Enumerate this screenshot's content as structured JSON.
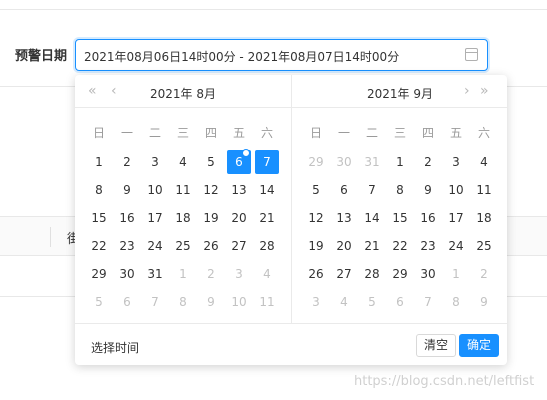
{
  "form": {
    "label": "预警日期",
    "range_value": "2021年08月06日14时00分 - 2021年08月07日14时00分"
  },
  "table": {
    "header_partial_text": "街"
  },
  "picker": {
    "nav": {
      "prev_year": "«",
      "prev_month": "‹",
      "next_month": "›",
      "next_year": "»"
    },
    "weekdays": [
      "日",
      "一",
      "二",
      "三",
      "四",
      "五",
      "六"
    ],
    "left": {
      "title": "2021年 8月",
      "days": [
        {
          "d": "1",
          "m": 0
        },
        {
          "d": "2",
          "m": 0
        },
        {
          "d": "3",
          "m": 0
        },
        {
          "d": "4",
          "m": 0
        },
        {
          "d": "5",
          "m": 0
        },
        {
          "d": "6",
          "m": 0,
          "sel": 1,
          "today": 1
        },
        {
          "d": "7",
          "m": 0,
          "sel": 1
        },
        {
          "d": "8",
          "m": 0
        },
        {
          "d": "9",
          "m": 0
        },
        {
          "d": "10",
          "m": 0
        },
        {
          "d": "11",
          "m": 0
        },
        {
          "d": "12",
          "m": 0
        },
        {
          "d": "13",
          "m": 0
        },
        {
          "d": "14",
          "m": 0
        },
        {
          "d": "15",
          "m": 0
        },
        {
          "d": "16",
          "m": 0
        },
        {
          "d": "17",
          "m": 0
        },
        {
          "d": "18",
          "m": 0
        },
        {
          "d": "19",
          "m": 0
        },
        {
          "d": "20",
          "m": 0
        },
        {
          "d": "21",
          "m": 0
        },
        {
          "d": "22",
          "m": 0
        },
        {
          "d": "23",
          "m": 0
        },
        {
          "d": "24",
          "m": 0
        },
        {
          "d": "25",
          "m": 0
        },
        {
          "d": "26",
          "m": 0
        },
        {
          "d": "27",
          "m": 0
        },
        {
          "d": "28",
          "m": 0
        },
        {
          "d": "29",
          "m": 0
        },
        {
          "d": "30",
          "m": 0
        },
        {
          "d": "31",
          "m": 0
        },
        {
          "d": "1",
          "m": 1
        },
        {
          "d": "2",
          "m": 1
        },
        {
          "d": "3",
          "m": 1
        },
        {
          "d": "4",
          "m": 1
        },
        {
          "d": "5",
          "m": 1
        },
        {
          "d": "6",
          "m": 1
        },
        {
          "d": "7",
          "m": 1
        },
        {
          "d": "8",
          "m": 1
        },
        {
          "d": "9",
          "m": 1
        },
        {
          "d": "10",
          "m": 1
        },
        {
          "d": "11",
          "m": 1
        }
      ]
    },
    "right": {
      "title": "2021年 9月",
      "days": [
        {
          "d": "29",
          "m": 1
        },
        {
          "d": "30",
          "m": 1
        },
        {
          "d": "31",
          "m": 1
        },
        {
          "d": "1",
          "m": 0
        },
        {
          "d": "2",
          "m": 0
        },
        {
          "d": "3",
          "m": 0
        },
        {
          "d": "4",
          "m": 0
        },
        {
          "d": "5",
          "m": 0
        },
        {
          "d": "6",
          "m": 0
        },
        {
          "d": "7",
          "m": 0
        },
        {
          "d": "8",
          "m": 0
        },
        {
          "d": "9",
          "m": 0
        },
        {
          "d": "10",
          "m": 0
        },
        {
          "d": "11",
          "m": 0
        },
        {
          "d": "12",
          "m": 0
        },
        {
          "d": "13",
          "m": 0
        },
        {
          "d": "14",
          "m": 0
        },
        {
          "d": "15",
          "m": 0
        },
        {
          "d": "16",
          "m": 0
        },
        {
          "d": "17",
          "m": 0
        },
        {
          "d": "18",
          "m": 0
        },
        {
          "d": "19",
          "m": 0
        },
        {
          "d": "20",
          "m": 0
        },
        {
          "d": "21",
          "m": 0
        },
        {
          "d": "22",
          "m": 0
        },
        {
          "d": "23",
          "m": 0
        },
        {
          "d": "24",
          "m": 0
        },
        {
          "d": "25",
          "m": 0
        },
        {
          "d": "26",
          "m": 0
        },
        {
          "d": "27",
          "m": 0
        },
        {
          "d": "28",
          "m": 0
        },
        {
          "d": "29",
          "m": 0
        },
        {
          "d": "30",
          "m": 0
        },
        {
          "d": "1",
          "m": 1
        },
        {
          "d": "2",
          "m": 1
        },
        {
          "d": "3",
          "m": 1
        },
        {
          "d": "4",
          "m": 1
        },
        {
          "d": "5",
          "m": 1
        },
        {
          "d": "6",
          "m": 1
        },
        {
          "d": "7",
          "m": 1
        },
        {
          "d": "8",
          "m": 1
        },
        {
          "d": "9",
          "m": 1
        }
      ]
    },
    "footer": {
      "select_time": "选择时间",
      "clear": "清空",
      "confirm": "确定"
    }
  },
  "watermark": "https://blog.csdn.net/leftfist",
  "colors": {
    "accent": "#1890ff",
    "muted_text": "#c2c2c2"
  },
  "icons": [
    "calendar-icon",
    "double-left-icon",
    "left-icon",
    "right-icon",
    "double-right-icon"
  ]
}
